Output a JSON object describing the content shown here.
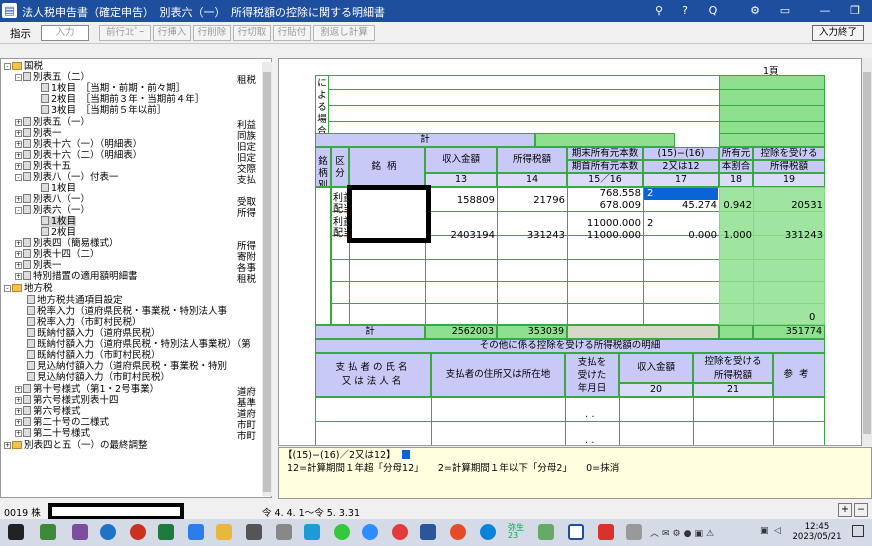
{
  "window": {
    "title": "法人税申告書（確定申告）　別表六（一）　所得税額の控除に関する明細書"
  },
  "toolbar": {
    "indicator_label": "指示",
    "buttons": [
      "入力",
      "前行ｺﾋﾟｰ",
      "行挿入",
      "行削除",
      "行切取",
      "行貼付",
      "割返し計算"
    ],
    "finish": "入力終了"
  },
  "tree": [
    {
      "t": "国税",
      "r": ""
    },
    {
      "t": "別表五（二）",
      "r": "租税"
    },
    {
      "t": "1枚目　［当期・前期・前々期］",
      "r": ""
    },
    {
      "t": "2枚目　［当期前３年・当期前４年］",
      "r": ""
    },
    {
      "t": "3枚目　［当期前５年以前］",
      "r": ""
    },
    {
      "t": "別表五（一）",
      "r": "利益"
    },
    {
      "t": "別表一",
      "r": "同族"
    },
    {
      "t": "別表十六（一）（明細表）",
      "r": "旧定"
    },
    {
      "t": "別表十六（二）（明細表）",
      "r": "旧定"
    },
    {
      "t": "別表十五",
      "r": "交際"
    },
    {
      "t": "別表八（一）付表一",
      "r": "支払"
    },
    {
      "t": "1枚目",
      "r": ""
    },
    {
      "t": "別表八（一）",
      "r": "受取"
    },
    {
      "t": "別表六（一）",
      "r": "所得"
    },
    {
      "t": "1枚目",
      "r": ""
    },
    {
      "t": "2枚目",
      "r": ""
    },
    {
      "t": "別表四（簡易様式）",
      "r": "所得"
    },
    {
      "t": "別表十四（二）",
      "r": "寄附"
    },
    {
      "t": "別表一",
      "r": "各事"
    },
    {
      "t": "特別措置の適用額明細書",
      "r": "租税"
    },
    {
      "t": "地方税",
      "r": ""
    },
    {
      "t": "地方税共通項目設定",
      "r": ""
    },
    {
      "t": "税率入力（道府県民税・事業税・特別法人事",
      "r": ""
    },
    {
      "t": "税率入力（市町村民税）",
      "r": ""
    },
    {
      "t": "既納付額入力（道府県民税）",
      "r": ""
    },
    {
      "t": "既納付額入力（道府県民税・特別法人事業税）（第",
      "r": ""
    },
    {
      "t": "既納付額入力（市町村民税）",
      "r": ""
    },
    {
      "t": "見込納付額入力（道府県民税・事業税・特別",
      "r": ""
    },
    {
      "t": "見込納付額入力（市町村民税）",
      "r": ""
    },
    {
      "t": "第十号様式（第1・2号事業）",
      "r": "道府"
    },
    {
      "t": "第六号様式別表十四",
      "r": "基準"
    },
    {
      "t": "第六号様式",
      "r": "道府"
    },
    {
      "t": "第二十号の二様式",
      "r": "市町"
    },
    {
      "t": "第二十号様式",
      "r": "市町"
    },
    {
      "t": "別表四と五（一）の最終調整",
      "r": ""
    }
  ],
  "form": {
    "page": "1頁",
    "side_top": "による場合",
    "total": "計",
    "h": {
      "kubun": "区分",
      "meigara": "銘柄",
      "c13": "収入金額",
      "c14": "所得税額",
      "c15": "期末所有元本数",
      "c16": "期首所有元本数",
      "c1516": "15／16",
      "c17a": "(15)−(16)",
      "c17b": "2又は12",
      "c18a": "所有元",
      "c18b": "本割合",
      "c19a": "控除を受ける",
      "c19b": "所得税額",
      "n13": "13",
      "n14": "14",
      "n15": "15／16",
      "n17": "17",
      "n18": "18",
      "n19": "19"
    },
    "side_label": "銘柄別簡便法による場合",
    "kubun_labels": [
      "利益",
      "配当",
      "利益",
      "配当"
    ],
    "rows": [
      {
        "r13": "158809",
        "r14": "21796",
        "r15": "768.558",
        "r16": "678.009",
        "r17a": "2",
        "r17b": "45.274",
        "r18": "0.942",
        "r19": "20531"
      },
      {
        "r13": "2403194",
        "r14": "331243",
        "r15": "11000.000",
        "r16": "11000.000",
        "r17a": "2",
        "r17b": "0.000",
        "r18": "1.000",
        "r19": "331243"
      }
    ],
    "tot": {
      "t13": "2562003",
      "t14": "353039",
      "t19": "351774",
      "zero": "0"
    },
    "other": {
      "title": "その他に係る控除を受ける所得税額の明細",
      "c1a": "支払者の氏名",
      "c1b": "又は法人名",
      "c2": "支払者の住所又は所在地",
      "c3a": "支払を",
      "c3b": "受けた",
      "c3c": "年月日",
      "c4": "収入金額",
      "c5a": "控除を受ける",
      "c5b": "所得税額",
      "c6": "参考",
      "n20": "20",
      "n21": "21",
      "dots": ". ."
    }
  },
  "hint": {
    "l1": "【(15)−(16)／2又は12】",
    "l2": "12=計算期間１年超「分母12」　　2=計算期間１年以下「分母2」　　0=抹消"
  },
  "status": {
    "code": "0019 株",
    "period": "令 4. 4. 1〜令 5. 3.31"
  },
  "taskbar": {
    "time": "12:45",
    "date": "2023/05/21",
    "appnum": "弥生23"
  }
}
